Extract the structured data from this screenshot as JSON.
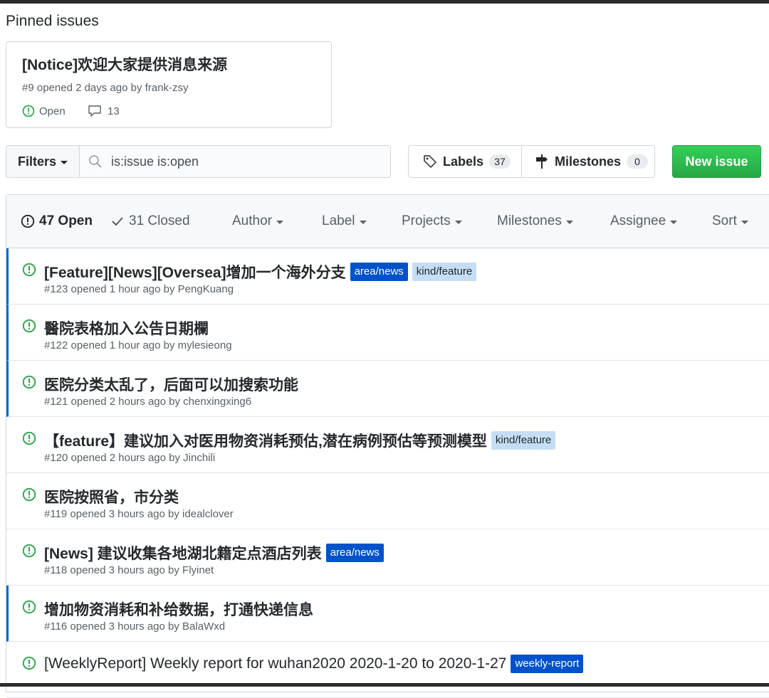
{
  "pinned": {
    "section_title": "Pinned issues",
    "issue": {
      "title": "[Notice]欢迎大家提供消息来源",
      "meta": "#9 opened 2 days ago by frank-zsy",
      "state": "Open",
      "comments": "13"
    }
  },
  "toolbar": {
    "filters_label": "Filters",
    "search_value": "is:issue is:open",
    "labels_label": "Labels",
    "labels_count": "37",
    "milestones_label": "Milestones",
    "milestones_count": "0",
    "new_issue_label": "New issue",
    "accent_color": "#28a745"
  },
  "header": {
    "open_label": "47 Open",
    "closed_label": "31 Closed",
    "filters": [
      "Author",
      "Label",
      "Projects",
      "Milestones",
      "Assignee",
      "Sort"
    ]
  },
  "issues": [
    {
      "title": "[Feature][News][Oversea]增加一个海外分支",
      "labels": [
        "area/news",
        "kind/feature"
      ],
      "meta": "#123 opened 1 hour ago by PengKuang"
    },
    {
      "title": "醫院表格加入公告日期欄",
      "labels": [],
      "meta": "#122 opened 1 hour ago by mylesieong"
    },
    {
      "title": "医院分类太乱了，后面可以加搜索功能",
      "labels": [],
      "meta": "#121 opened 2 hours ago by chenxingxing6"
    },
    {
      "title": "【feature】建议加入对医用物资消耗预估,潜在病例预估等预测模型",
      "labels": [
        "kind/feature"
      ],
      "meta": "#120 opened 2 hours ago by Jinchili"
    },
    {
      "title": "医院按照省，市分类",
      "labels": [],
      "meta": "#119 opened 3 hours ago by idealclover"
    },
    {
      "title": "[News] 建议收集各地湖北籍定点酒店列表",
      "labels": [
        "area/news"
      ],
      "meta": "#118 opened 3 hours ago by Flyinet"
    },
    {
      "title": "增加物资消耗和补给数据，打通快递信息",
      "labels": [],
      "meta": "#116 opened 3 hours ago by BalaWxd"
    },
    {
      "title": "[WeeklyReport] Weekly report for wuhan2020 2020-1-20 to 2020-1-27",
      "labels": [
        "weekly-report"
      ],
      "meta": ""
    }
  ],
  "label_colors": {
    "area/news": "#0052cc",
    "kind/feature": "#c5def5",
    "weekly-report": "#0052cc"
  }
}
